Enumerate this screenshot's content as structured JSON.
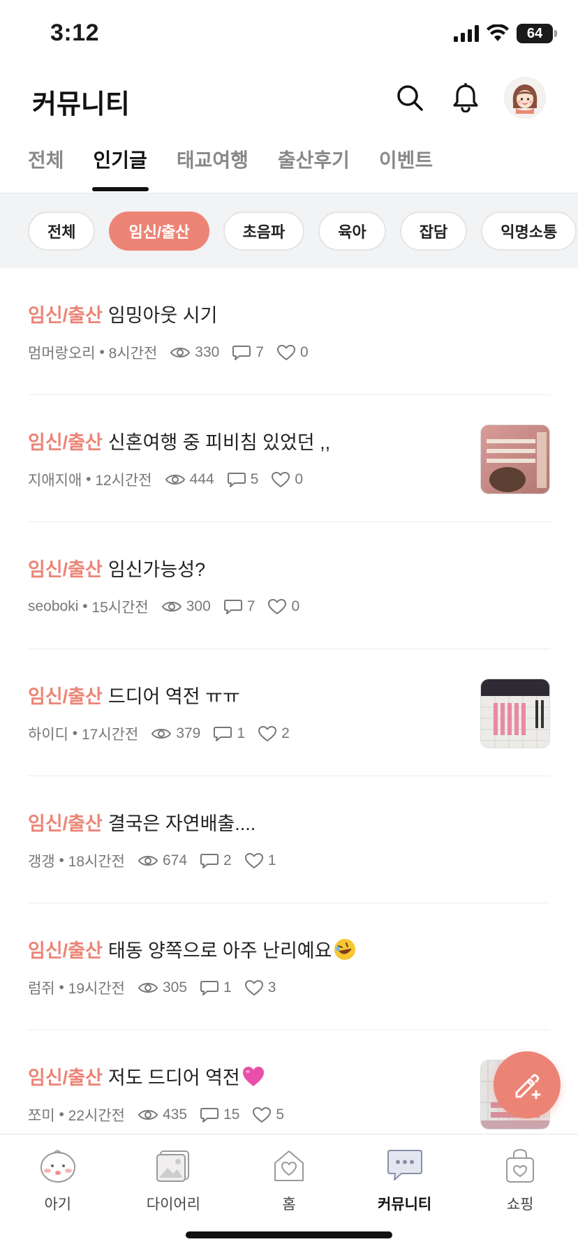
{
  "status_bar": {
    "time": "3:12",
    "battery": "64"
  },
  "header": {
    "title": "커뮤니티"
  },
  "main_tabs": [
    {
      "label": "전체"
    },
    {
      "label": "인기글"
    },
    {
      "label": "태교여행"
    },
    {
      "label": "출산후기"
    },
    {
      "label": "이벤트"
    }
  ],
  "chips": [
    {
      "label": "전체"
    },
    {
      "label": "임신/출산"
    },
    {
      "label": "초음파"
    },
    {
      "label": "육아"
    },
    {
      "label": "잡담"
    },
    {
      "label": "익명소통"
    }
  ],
  "posts": [
    {
      "category": "임신/출산",
      "title": "임밍아웃 시기",
      "author": "멈머랑오리",
      "time": "8시간전",
      "views": "330",
      "comments": "7",
      "likes": "0"
    },
    {
      "category": "임신/출산",
      "title": "신혼여행 중 피비침 있었던 ,,",
      "author": "지애지애",
      "time": "12시간전",
      "views": "444",
      "comments": "5",
      "likes": "0"
    },
    {
      "category": "임신/출산",
      "title": "임신가능성?",
      "author": "seoboki",
      "time": "15시간전",
      "views": "300",
      "comments": "7",
      "likes": "0"
    },
    {
      "category": "임신/출산",
      "title": "드디어 역전 ㅠㅠ",
      "author": "하이디",
      "time": "17시간전",
      "views": "379",
      "comments": "1",
      "likes": "2"
    },
    {
      "category": "임신/출산",
      "title": "결국은 자연배출....",
      "author": "갱갱",
      "time": "18시간전",
      "views": "674",
      "comments": "2",
      "likes": "1"
    },
    {
      "category": "임신/출산",
      "title": "태동 양쪽으로 아주 난리예요",
      "author": "럼쥐",
      "time": "19시간전",
      "views": "305",
      "comments": "1",
      "likes": "3"
    },
    {
      "category": "임신/출산",
      "title": "저도 드디어 역전",
      "author": "쪼미",
      "time": "22시간전",
      "views": "435",
      "comments": "15",
      "likes": "5"
    }
  ],
  "bottom_nav": [
    {
      "label": "아기",
      "icon": "baby-face-icon"
    },
    {
      "label": "다이어리",
      "icon": "diary-photo-icon"
    },
    {
      "label": "홈",
      "icon": "home-heart-icon"
    },
    {
      "label": "커뮤니티",
      "icon": "chat-bubble-icon"
    },
    {
      "label": "쇼핑",
      "icon": "shopping-bag-icon"
    }
  ],
  "colors": {
    "accent": "#ec8476",
    "text": "#222222",
    "muted": "#777777",
    "chip_bg": "#f2f3f5"
  }
}
